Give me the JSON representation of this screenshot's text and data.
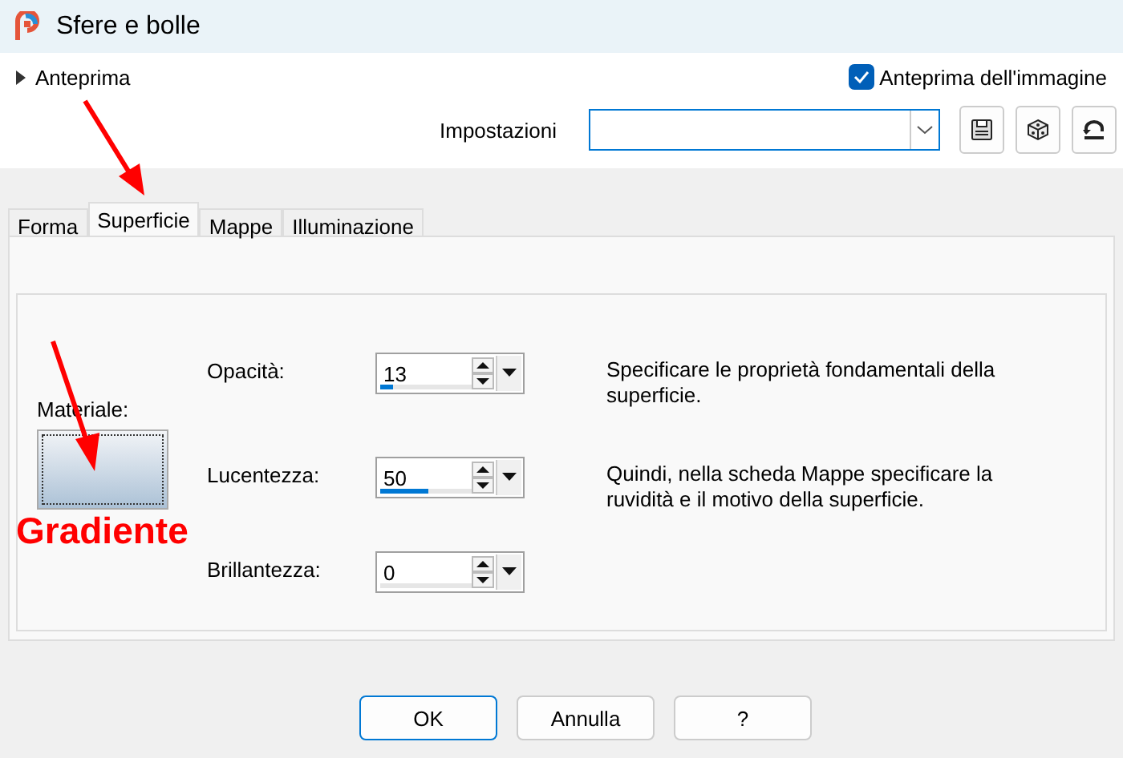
{
  "window": {
    "title": "Sfere e bolle"
  },
  "preview": {
    "label": "Anteprima",
    "expanded": false
  },
  "image_preview": {
    "label": "Anteprima dell'immagine",
    "checked": true
  },
  "settings": {
    "label": "Impostazioni"
  },
  "tabs": [
    {
      "label": "Forma",
      "selected": false
    },
    {
      "label": "Superficie",
      "selected": true
    },
    {
      "label": "Mappe",
      "selected": false
    },
    {
      "label": "Illuminazione",
      "selected": false
    }
  ],
  "material": {
    "label": "Materiale:"
  },
  "fields": [
    {
      "label": "Opacità:",
      "value": "13",
      "level": 0.13
    },
    {
      "label": "Lucentezza:",
      "value": "50",
      "level": 0.5
    },
    {
      "label": "Brillantezza:",
      "value": "0",
      "level": 0
    }
  ],
  "descriptions": [
    "Specificare le proprietà fondamentali della superficie.",
    "Quindi, nella scheda Mappe specificare la ruvidità e il motivo della superficie."
  ],
  "buttons": [
    {
      "label": "OK",
      "default": true
    },
    {
      "label": "Annulla",
      "default": false
    },
    {
      "label": "?",
      "default": false
    }
  ],
  "annotation": {
    "text": "Gradiente"
  }
}
